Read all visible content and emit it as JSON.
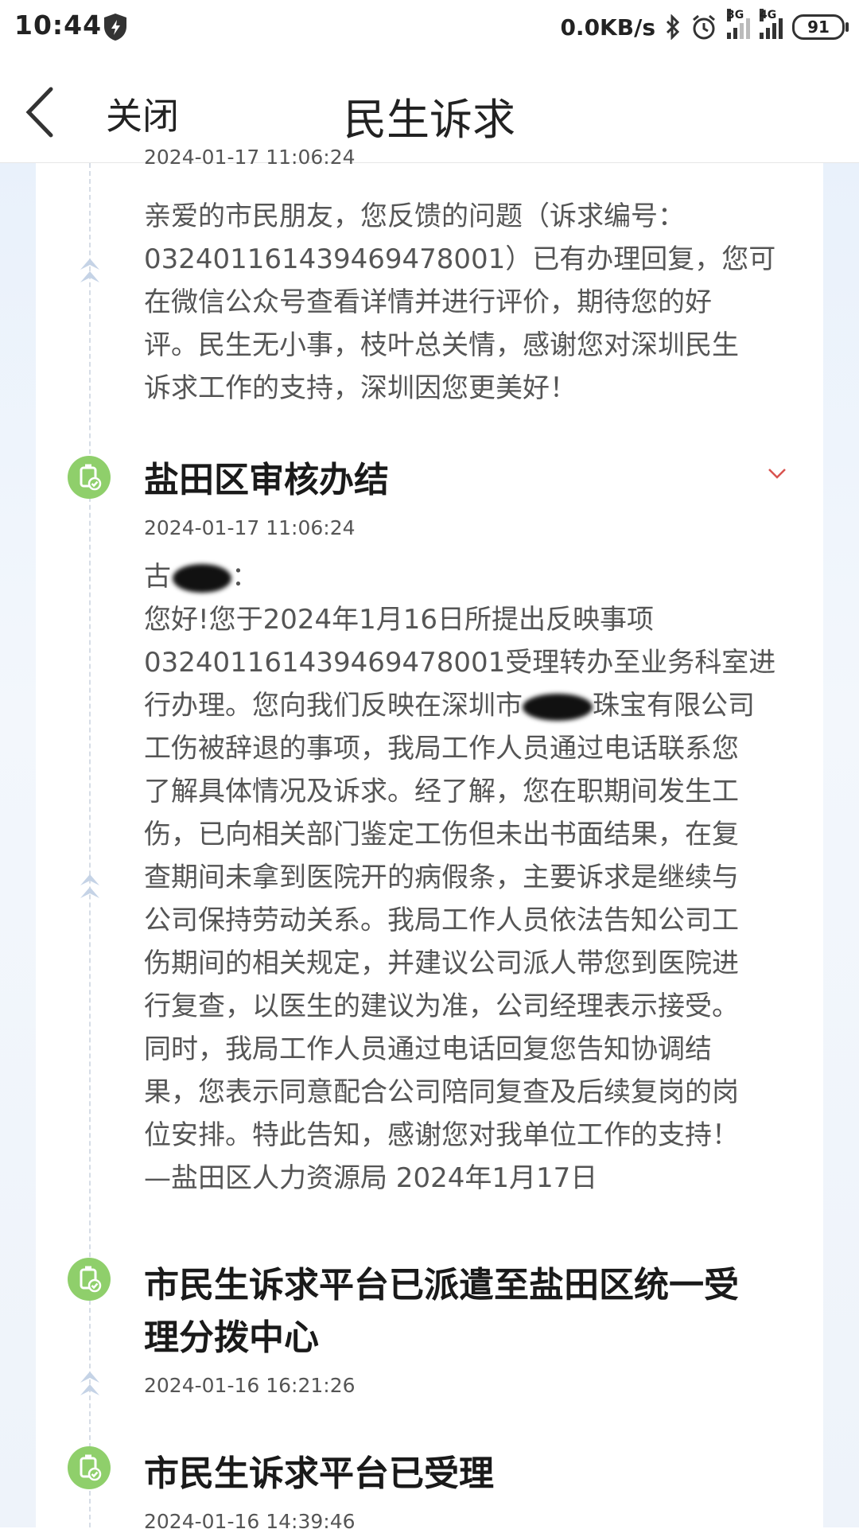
{
  "status_bar": {
    "time": "10:44",
    "network_speed": "0.0KB/s",
    "signal1_tag": "3G",
    "signal2_tag": "4G",
    "battery": "91"
  },
  "navbar": {
    "close_label": "关闭",
    "title": "民生诉求"
  },
  "timeline": {
    "top_clipped_time": "2024-01-17 11:06:24",
    "reply_notice": "亲爱的市民朋友，您反馈的问题（诉求编号：\n032401161439469478001）已有办理回复，您可\n在微信公众号查看详情并进行评价，期待您的好\n评。民生无小事，枝叶总关情，感谢您对深圳民生\n诉求工作的支持，深圳因您更美好！",
    "entries": [
      {
        "title": "盐田区审核办结",
        "time": "2024-01-17 11:06:24",
        "greeting_prefix": "古",
        "greeting_suffix": "：",
        "body_before_redact": "您好!您于2024年1月16日所提出反映事项\n032401161439469478001受理转办至业务科室进\n行办理。您向我们反映在深圳市",
        "body_after_redact": "珠宝有限公司\n工伤被辞退的事项，我局工作人员通过电话联系您\n了解具体情况及诉求。经了解，您在职期间发生工\n伤，已向相关部门鉴定工伤但未出书面结果，在复\n查期间未拿到医院开的病假条，主要诉求是继续与\n公司保持劳动关系。我局工作人员依法告知公司工\n伤期间的相关规定，并建议公司派人带您到医院进\n行复查，以医生的建议为准，公司经理表示接受。\n同时，我局工作人员通过电话回复您告知协调结\n果，您表示同意配合公司陪同复查及后续复岗的岗\n位安排。特此告知，感谢您对我单位工作的支持！\n—盐田区人力资源局 2024年1月17日"
      },
      {
        "title": "市民生诉求平台已派遣至盐田区统一受\n理分拨中心",
        "time": "2024-01-16 16:21:26"
      },
      {
        "title": "市民生诉求平台已受理",
        "time": "2024-01-16 14:39:46"
      }
    ]
  },
  "colors": {
    "node_green": "#8fcf6b",
    "chevron_red": "#d9534f",
    "arrow_blue": "#c5d3e6"
  },
  "icons": [
    "shield-icon",
    "bluetooth-icon",
    "alarm-icon",
    "back-icon",
    "chevron-down-icon",
    "timeline-node-icon",
    "arrow-up-icon"
  ]
}
